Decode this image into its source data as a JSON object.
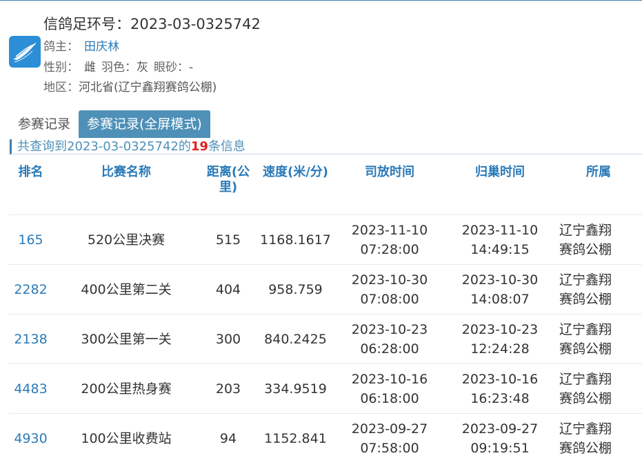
{
  "header": {
    "title_label": "信鸽足环号：",
    "ring_number": "2023-03-0325742",
    "owner_label": "鸽主：",
    "owner_name": "田庆林",
    "gender_label": "性别：",
    "gender": "雌",
    "color_label": "羽色：",
    "color": "灰",
    "eye_label": "眼砂：",
    "eye": "-",
    "region_label": "地区：",
    "region": "河北省(辽宁鑫翔赛鸽公棚)",
    "logo_icon": "pigeon-logo-icon",
    "logo_color": "#2b8ed6"
  },
  "tabs": [
    {
      "label": "参赛记录",
      "active": false
    },
    {
      "label": "参赛记录(全屏模式)",
      "active": true
    }
  ],
  "summary": {
    "prefix": "共查询到2023-03-0325742的",
    "count": "19",
    "suffix": "条信息"
  },
  "table": {
    "headers": [
      "排名",
      "比赛名称",
      "距离(公里)",
      "速度(米/分)",
      "司放时间",
      "归巢时间",
      "所属"
    ],
    "rows": [
      {
        "rank": "165",
        "race": "520公里决赛",
        "distance": "515",
        "speed": "1168.1617",
        "release_date": "2023-11-10",
        "release_time": "07:28:00",
        "arrival_date": "2023-11-10",
        "arrival_time": "14:49:15",
        "club_line1": "辽宁鑫翔",
        "club_line2": "赛鸽公棚"
      },
      {
        "rank": "2282",
        "race": "400公里第二关",
        "distance": "404",
        "speed": "958.759",
        "release_date": "2023-10-30",
        "release_time": "07:08:00",
        "arrival_date": "2023-10-30",
        "arrival_time": "14:08:07",
        "club_line1": "辽宁鑫翔",
        "club_line2": "赛鸽公棚"
      },
      {
        "rank": "2138",
        "race": "300公里第一关",
        "distance": "300",
        "speed": "840.2425",
        "release_date": "2023-10-23",
        "release_time": "06:28:00",
        "arrival_date": "2023-10-23",
        "arrival_time": "12:24:28",
        "club_line1": "辽宁鑫翔",
        "club_line2": "赛鸽公棚"
      },
      {
        "rank": "4483",
        "race": "200公里热身赛",
        "distance": "203",
        "speed": "334.9519",
        "release_date": "2023-10-16",
        "release_time": "06:18:00",
        "arrival_date": "2023-10-16",
        "arrival_time": "16:23:48",
        "club_line1": "辽宁鑫翔",
        "club_line2": "赛鸽公棚"
      },
      {
        "rank": "4930",
        "race": "100公里收费站",
        "distance": "94",
        "speed": "1152.841",
        "release_date": "2023-09-27",
        "release_time": "07:58:00",
        "arrival_date": "2023-09-27",
        "arrival_time": "09:19:51",
        "club_line1": "辽宁鑫翔",
        "club_line2": "赛鸽公棚"
      }
    ]
  },
  "colors": {
    "accent": "#2a7ab8",
    "tab_active_bg": "#4e90b7",
    "count_red": "#e02020"
  }
}
